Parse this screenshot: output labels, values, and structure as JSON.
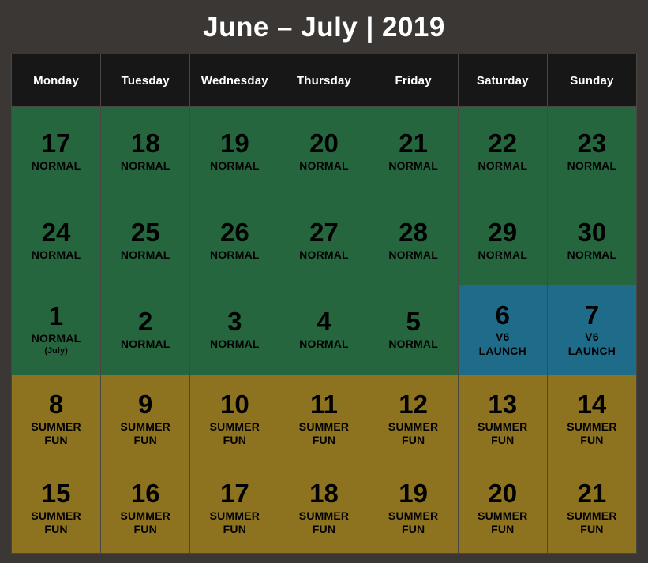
{
  "header": {
    "title": "June – July | 2019"
  },
  "colors": {
    "background": "#3a3734",
    "grid_line": "#4a4642",
    "head_cell": "#171717",
    "head_text": "#ffffff",
    "normal": "#26663f",
    "launch": "#1f6c8a",
    "summer": "#8d7220",
    "day_text": "#000000"
  },
  "weekdays": [
    {
      "label": "Monday"
    },
    {
      "label": "Tuesday"
    },
    {
      "label": "Wednesday"
    },
    {
      "label": "Thursday"
    },
    {
      "label": "Friday"
    },
    {
      "label": "Saturday"
    },
    {
      "label": "Sunday"
    }
  ],
  "legend": {
    "normal_label": "NORMAL",
    "launch_label": "V6\nLAUNCH",
    "summer_label": "SUMMER\nFUN"
  },
  "weeks": [
    {
      "days": [
        {
          "number": "17",
          "label": "NORMAL",
          "sub": "",
          "type": "normal"
        },
        {
          "number": "18",
          "label": "NORMAL",
          "sub": "",
          "type": "normal"
        },
        {
          "number": "19",
          "label": "NORMAL",
          "sub": "",
          "type": "normal"
        },
        {
          "number": "20",
          "label": "NORMAL",
          "sub": "",
          "type": "normal"
        },
        {
          "number": "21",
          "label": "NORMAL",
          "sub": "",
          "type": "normal"
        },
        {
          "number": "22",
          "label": "NORMAL",
          "sub": "",
          "type": "normal"
        },
        {
          "number": "23",
          "label": "NORMAL",
          "sub": "",
          "type": "normal"
        }
      ]
    },
    {
      "days": [
        {
          "number": "24",
          "label": "NORMAL",
          "sub": "",
          "type": "normal"
        },
        {
          "number": "25",
          "label": "NORMAL",
          "sub": "",
          "type": "normal"
        },
        {
          "number": "26",
          "label": "NORMAL",
          "sub": "",
          "type": "normal"
        },
        {
          "number": "27",
          "label": "NORMAL",
          "sub": "",
          "type": "normal"
        },
        {
          "number": "28",
          "label": "NORMAL",
          "sub": "",
          "type": "normal"
        },
        {
          "number": "29",
          "label": "NORMAL",
          "sub": "",
          "type": "normal"
        },
        {
          "number": "30",
          "label": "NORMAL",
          "sub": "",
          "type": "normal"
        }
      ]
    },
    {
      "days": [
        {
          "number": "1",
          "label": "NORMAL",
          "sub": "(July)",
          "type": "normal"
        },
        {
          "number": "2",
          "label": "NORMAL",
          "sub": "",
          "type": "normal"
        },
        {
          "number": "3",
          "label": "NORMAL",
          "sub": "",
          "type": "normal"
        },
        {
          "number": "4",
          "label": "NORMAL",
          "sub": "",
          "type": "normal"
        },
        {
          "number": "5",
          "label": "NORMAL",
          "sub": "",
          "type": "normal"
        },
        {
          "number": "6",
          "label": "V6\nLAUNCH",
          "sub": "",
          "type": "launch"
        },
        {
          "number": "7",
          "label": "V6\nLAUNCH",
          "sub": "",
          "type": "launch"
        }
      ]
    },
    {
      "days": [
        {
          "number": "8",
          "label": "SUMMER\nFUN",
          "sub": "",
          "type": "summer"
        },
        {
          "number": "9",
          "label": "SUMMER\nFUN",
          "sub": "",
          "type": "summer"
        },
        {
          "number": "10",
          "label": "SUMMER\nFUN",
          "sub": "",
          "type": "summer"
        },
        {
          "number": "11",
          "label": "SUMMER\nFUN",
          "sub": "",
          "type": "summer"
        },
        {
          "number": "12",
          "label": "SUMMER\nFUN",
          "sub": "",
          "type": "summer"
        },
        {
          "number": "13",
          "label": "SUMMER\nFUN",
          "sub": "",
          "type": "summer"
        },
        {
          "number": "14",
          "label": "SUMMER\nFUN",
          "sub": "",
          "type": "summer"
        }
      ]
    },
    {
      "days": [
        {
          "number": "15",
          "label": "SUMMER\nFUN",
          "sub": "",
          "type": "summer"
        },
        {
          "number": "16",
          "label": "SUMMER\nFUN",
          "sub": "",
          "type": "summer"
        },
        {
          "number": "17",
          "label": "SUMMER\nFUN",
          "sub": "",
          "type": "summer"
        },
        {
          "number": "18",
          "label": "SUMMER\nFUN",
          "sub": "",
          "type": "summer"
        },
        {
          "number": "19",
          "label": "SUMMER\nFUN",
          "sub": "",
          "type": "summer"
        },
        {
          "number": "20",
          "label": "SUMMER\nFUN",
          "sub": "",
          "type": "summer"
        },
        {
          "number": "21",
          "label": "SUMMER\nFUN",
          "sub": "",
          "type": "summer"
        }
      ]
    }
  ]
}
